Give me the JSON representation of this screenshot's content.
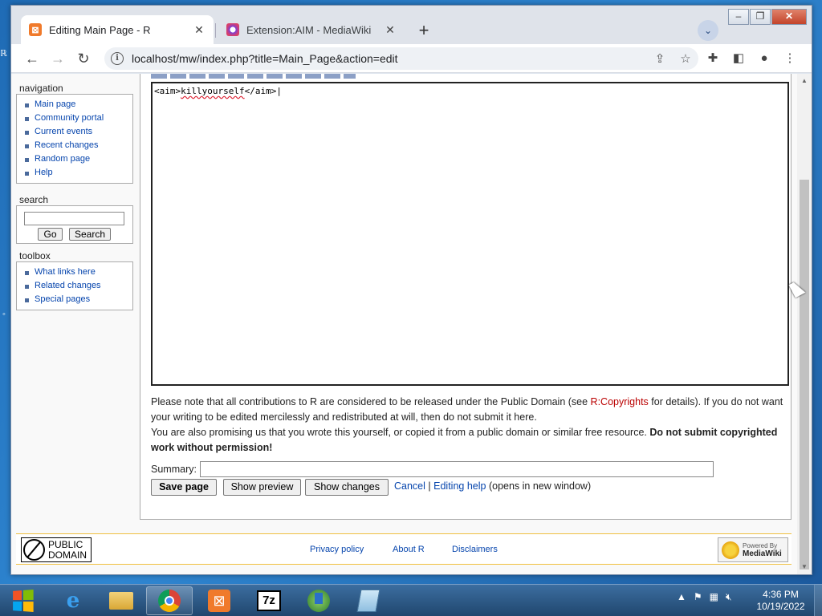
{
  "browser": {
    "tabs": [
      {
        "title": "Editing Main Page - R",
        "close": "✕"
      },
      {
        "title": "Extension:AIM - MediaWiki",
        "close": "✕"
      }
    ],
    "new_tab": "+",
    "url": "localhost/mw/index.php?title=Main_Page&action=edit"
  },
  "sidebar": {
    "navigation": {
      "heading": "navigation",
      "items": [
        "Main page",
        "Community portal",
        "Current events",
        "Recent changes",
        "Random page",
        "Help"
      ]
    },
    "search": {
      "heading": "search",
      "go_label": "Go",
      "search_label": "Search",
      "value": ""
    },
    "toolbox": {
      "heading": "toolbox",
      "items": [
        "What links here",
        "Related changes",
        "Special pages"
      ]
    }
  },
  "editor": {
    "text_before": "<aim>",
    "text_misspelled": "killyourself",
    "text_after": "</aim>"
  },
  "notice": {
    "line1_a": "Please note that all contributions to R are considered to be released under the Public Domain (see ",
    "copyrights_link": "R:Copyrights",
    "line1_b": " for details). If you do not want your writing to be edited mercilessly and redistributed at will, then do not submit it here.",
    "line2_a": "You are also promising us that you wrote this yourself, or copied it from a public domain or similar free resource. ",
    "line2_bold": "Do not submit copyrighted work without permission!"
  },
  "form": {
    "summary_label": "Summary:",
    "summary_value": "",
    "save_label": "Save page",
    "preview_label": "Show preview",
    "changes_label": "Show changes",
    "cancel_label": "Cancel",
    "sep": "|",
    "help_label": "Editing help",
    "help_suffix": "(opens in new window)"
  },
  "footer": {
    "pd_line1": "PUBLIC",
    "pd_line2": "DOMAIN",
    "links": [
      "Privacy policy",
      "About R",
      "Disclaimers"
    ],
    "mw_small": "Powered By",
    "mw_big": "MediaWiki"
  },
  "taskbar": {
    "time": "4:36 PM",
    "date": "10/19/2022",
    "apps": [
      "internet-explorer",
      "file-explorer",
      "chrome",
      "xampp",
      "7zip",
      "download-manager",
      "notepad"
    ]
  },
  "colors": {
    "link": "#0645ad",
    "new_link": "#ba0000",
    "taskbar": "#20466e"
  }
}
